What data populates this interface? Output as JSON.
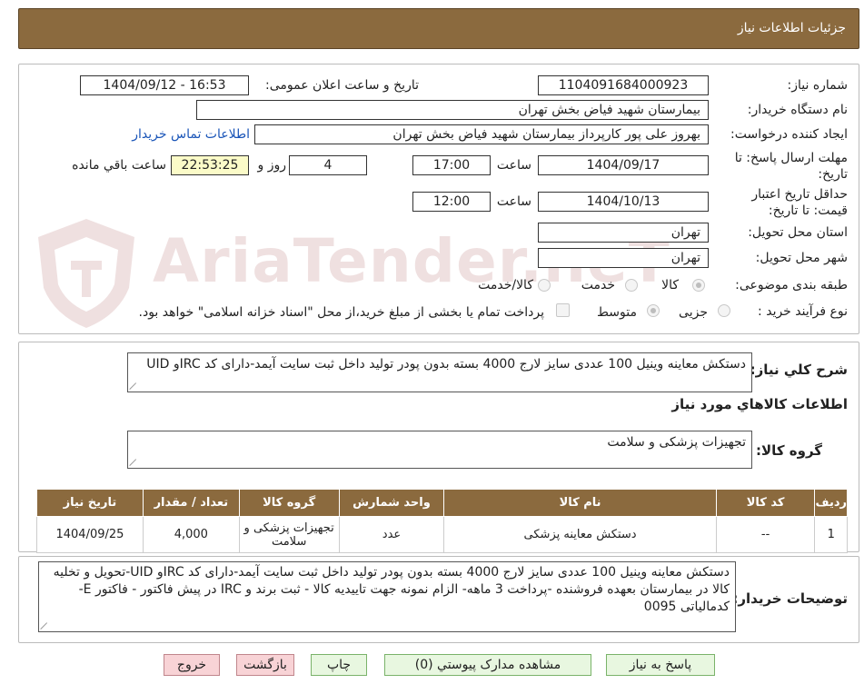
{
  "header": {
    "title": "جزئیات اطلاعات نیاز"
  },
  "fields": {
    "need_number_label": "شماره نیاز:",
    "need_number": "1104091684000923",
    "announce_label": "تاریخ و ساعت اعلان عمومی:",
    "announce_value": "1404/09/12 - 16:53",
    "buyer_org_label": "نام دستگاه خریدار:",
    "buyer_org": "بیمارستان شهید فیاض بخش تهران",
    "requester_label": "ایجاد کننده درخواست:",
    "requester": "بهروز علی پور کارپرداز بیمارستان شهید فیاض بخش تهران",
    "contact_link": "اطلاعات تماس خریدار",
    "deadline_label_1": "مهلت ارسال پاسخ: تا",
    "deadline_label_2": "تاریخ:",
    "deadline_date": "1404/09/17",
    "time_label": "ساعت",
    "deadline_time": "17:00",
    "days_value": "4",
    "days_label": "روز و",
    "remaining_time": "22:53:25",
    "remaining_label": "ساعت باقي مانده",
    "validity_label_1": "حداقل تاریخ اعتبار",
    "validity_label_2": "قیمت: تا تاریخ:",
    "validity_date": "1404/10/13",
    "validity_time": "12:00",
    "province_label": "استان محل تحویل:",
    "province": "تهران",
    "city_label": "شهر محل تحویل:",
    "city": "تهران",
    "category_label": "طبقه بندی موضوعی:",
    "category_options": [
      "کالا",
      "خدمت",
      "کالا/خدمت"
    ],
    "category_selected": "کالا",
    "process_label": "نوع فرآیند خرید :",
    "process_options": [
      "جزیی",
      "متوسط"
    ],
    "process_selected": "متوسط",
    "payment_note": "پرداخت تمام یا بخشی از مبلغ خرید،از محل \"اسناد خزانه اسلامی\" خواهد بود."
  },
  "summary": {
    "label": "شرح کلي نياز:",
    "value": "دستکش معاینه وینیل 100 عددی سایز لارج 4000 بسته بدون پودر تولید داخل ثبت سایت آیمد-دارای کد IRCو UID",
    "goods_info_title": "اطلاعات کالاهاي مورد نياز",
    "group_label": "گروه کالا:",
    "group_value": "تجهیزات پزشکی و سلامت"
  },
  "table": {
    "headers": [
      "ردیف",
      "کد کالا",
      "نام کالا",
      "واحد شمارش",
      "گروه کالا",
      "تعداد / مقدار",
      "تاریخ نیاز"
    ],
    "rows": [
      [
        "1",
        "--",
        "دستکش معاینه پزشکی",
        "عدد",
        "تجهیزات پزشکی و سلامت",
        "4,000",
        "1404/09/25"
      ]
    ]
  },
  "buyer_notes": {
    "label": "توضیحات خریدار:",
    "value": "دستکش معاینه وینیل 100 عددی سایز لارج 4000 بسته بدون پودر تولید داخل ثبت سایت آیمد-دارای کد IRCو UID-تحویل و تخلیه کالا در بیمارستان بعهده فروشنده -پرداخت 3 ماهه- الزام نمونه جهت تاییدیه کالا - ثبت برند و IRC در پیش فاکتور - فاکتور E- کدمالیاتی 0095"
  },
  "buttons": {
    "reply": "پاسخ به نیاز",
    "attachments": "مشاهده مدارک پیوستي (0)",
    "print": "چاپ",
    "back": "بازگشت",
    "exit": "خروج"
  },
  "watermark": {
    "text": "AriaTender.neT"
  },
  "colors": {
    "header": "#8b6a3e",
    "link": "#1a55b8",
    "remaining_bg": "#fbfbc8"
  }
}
